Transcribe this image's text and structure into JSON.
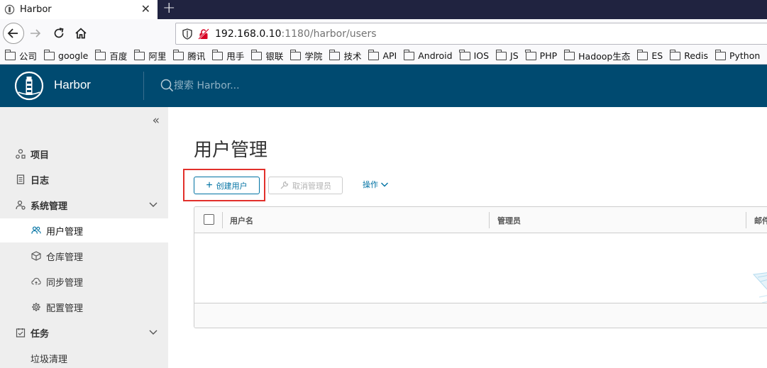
{
  "browser": {
    "tab_title": "Harbor",
    "close_symbol": "✕",
    "new_tab_symbol": "+",
    "url_host": "192.168.0.10",
    "url_path": ":1180/harbor/users",
    "bookmarks": [
      "公司",
      "google",
      "百度",
      "阿里",
      "腾讯",
      "甩手",
      "银联",
      "学院",
      "技术",
      "API",
      "Android",
      "IOS",
      "JS",
      "PHP",
      "Hadoop生态",
      "ES",
      "Redis",
      "Python"
    ]
  },
  "header": {
    "brand": "Harbor",
    "search_placeholder": "搜索 Harbor..."
  },
  "sidebar": {
    "collapse_symbol": "«",
    "items": [
      {
        "label": "项目",
        "icon": "project-icon"
      },
      {
        "label": "日志",
        "icon": "log-icon"
      },
      {
        "label": "系统管理",
        "icon": "admin-icon"
      },
      {
        "label": "用户管理",
        "icon": "users-icon"
      },
      {
        "label": "仓库管理",
        "icon": "registry-icon"
      },
      {
        "label": "同步管理",
        "icon": "cloud-sync-icon"
      },
      {
        "label": "配置管理",
        "icon": "settings-icon"
      },
      {
        "label": "任务",
        "icon": "tasks-icon"
      },
      {
        "label": "垃圾清理",
        "icon": ""
      }
    ]
  },
  "main": {
    "title": "用户管理",
    "create_label": "创建用户",
    "revoke_admin_label": "取消管理员",
    "actions_label": "操作",
    "columns": [
      "用户名",
      "管理员",
      "邮件"
    ]
  },
  "colors": {
    "header_bg": "#004a70",
    "accent": "#0072a3",
    "highlight": "#e2302b",
    "sidebar_bg": "#eeeeee"
  }
}
